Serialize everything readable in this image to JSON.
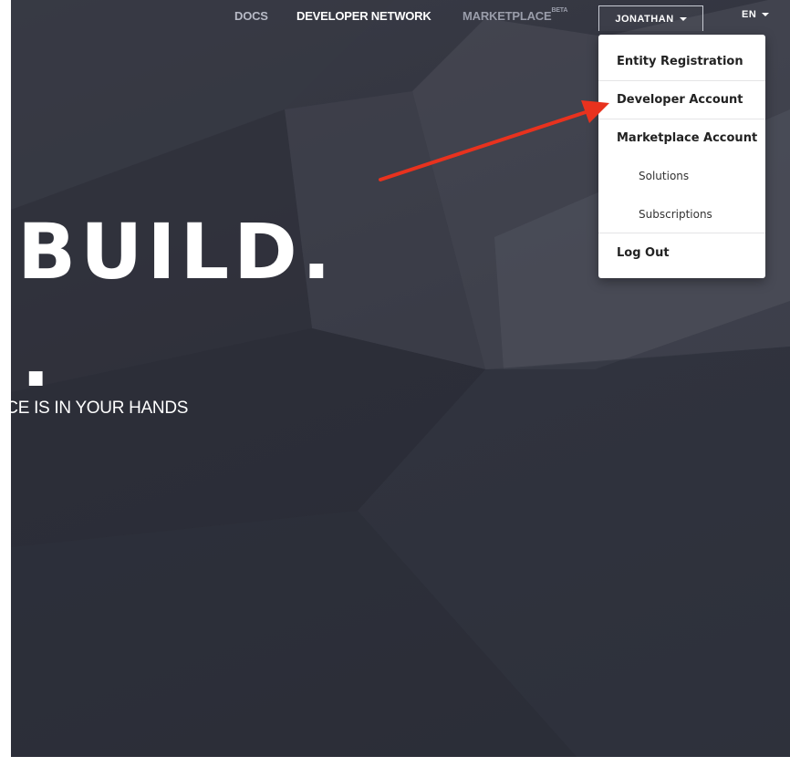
{
  "nav": {
    "docs": "DOCS",
    "developer_network": "DEVELOPER NETWORK",
    "marketplace": "MARKETPLACE",
    "marketplace_badge": "BETA",
    "user": "JONATHAN",
    "language": "EN"
  },
  "user_menu": {
    "entity_registration": "Entity Registration",
    "developer_account": "Developer Account",
    "marketplace_account": "Marketplace Account",
    "solutions": "Solutions",
    "subscriptions": "Subscriptions",
    "log_out": "Log Out"
  },
  "hero": {
    "title_line1": ". BUILD.",
    "title_line2": "H.",
    "subtitle": "IMERCE IS IN YOUR HANDS"
  },
  "annotation": {
    "arrow_color": "#e8321e",
    "arrow_target": "user_menu.developer_account"
  },
  "colors": {
    "hero_background": "#30323d",
    "dropdown_background": "#ffffff",
    "annotation_arrow": "#e8321e"
  }
}
